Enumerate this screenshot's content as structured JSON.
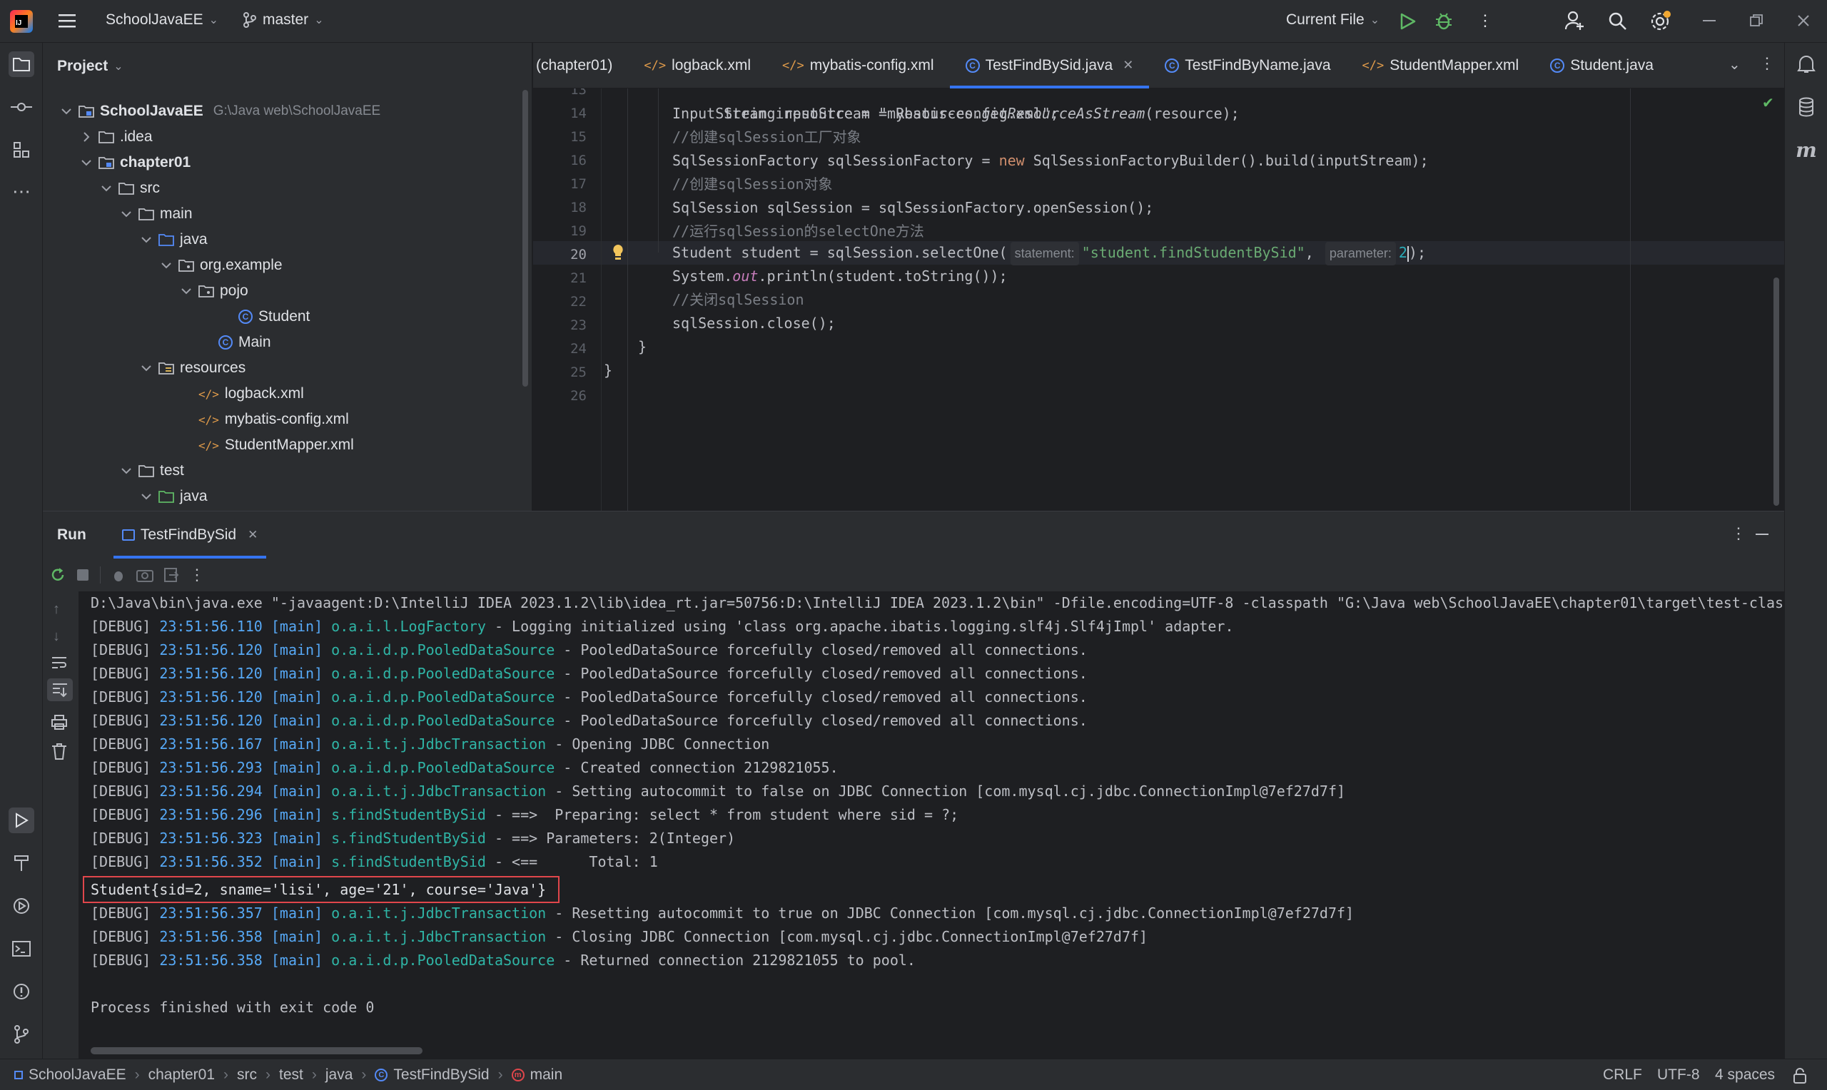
{
  "titlebar": {
    "project": "SchoolJavaEE",
    "branch": "master",
    "run_config": "Current File"
  },
  "project_panel": {
    "title": "Project",
    "tree": [
      {
        "label": "SchoolJavaEE",
        "path": "G:\\Java web\\SchoolJavaEE"
      },
      {
        "label": ".idea"
      },
      {
        "label": "chapter01"
      },
      {
        "label": "src"
      },
      {
        "label": "main"
      },
      {
        "label": "java"
      },
      {
        "label": "org.example"
      },
      {
        "label": "pojo"
      },
      {
        "label": "Student"
      },
      {
        "label": "Main"
      },
      {
        "label": "resources"
      },
      {
        "label": "logback.xml"
      },
      {
        "label": "mybatis-config.xml"
      },
      {
        "label": "StudentMapper.xml"
      },
      {
        "label": "test"
      },
      {
        "label": "java"
      }
    ]
  },
  "tabs": [
    {
      "label": "(chapter01)"
    },
    {
      "label": "logback.xml"
    },
    {
      "label": "mybatis-config.xml"
    },
    {
      "label": "TestFindBySid.java"
    },
    {
      "label": "TestFindByName.java"
    },
    {
      "label": "StudentMapper.xml"
    },
    {
      "label": "Student.java"
    }
  ],
  "editor": {
    "line_numbers": [
      "13",
      "14",
      "15",
      "16",
      "17",
      "18",
      "19",
      "20",
      "21",
      "22",
      "23",
      "24",
      "25",
      "26"
    ],
    "lines": {
      "l13": "String resource = \"mybatis-config.xml\";",
      "l14a": "InputStream inputStream = Resources.",
      "l14b": "getResourceAsStream",
      "l14c": "(resource);",
      "l15": "//创建sqlSession工厂对象",
      "l16a": "SqlSessionFactory sqlSessionFactory = ",
      "l16b": "new",
      "l16c": " SqlSessionFactoryBuilder().build(inputStream);",
      "l17": "//创建sqlSession对象",
      "l18": "SqlSession sqlSession = sqlSessionFactory.openSession();",
      "l19": "//运行sqlSession的selectOne方法",
      "l20a": "Student student = sqlSession.selectOne(",
      "l20_hint1": "statement:",
      "l20b": "\"student.findStudentBySid\"",
      "l20c": ", ",
      "l20_hint2": "parameter:",
      "l20d": "2",
      "l20e": ");",
      "l21a": "System.",
      "l21b": "out",
      "l21c": ".println(student.toString());",
      "l22": "//关闭sqlSession",
      "l23": "sqlSession.close();",
      "l24": "}",
      "l25": "}"
    }
  },
  "run_panel": {
    "title": "Run",
    "tab": "TestFindBySid",
    "cmd": "D:\\Java\\bin\\java.exe \"-javaagent:D:\\IntelliJ IDEA 2023.1.2\\lib\\idea_rt.jar=50756:D:\\IntelliJ IDEA 2023.1.2\\bin\" -Dfile.encoding=UTF-8 -classpath \"G:\\Java web\\SchoolJavaEE\\chapter01\\target\\test-class",
    "logs": [
      {
        "lvl": "[DEBUG]",
        "ts": "23:51:56.110",
        "thr": "[main]",
        "src": "o.a.i.l.LogFactory",
        "msg": " - Logging initialized using 'class org.apache.ibatis.logging.slf4j.Slf4jImpl' adapter."
      },
      {
        "lvl": "[DEBUG]",
        "ts": "23:51:56.120",
        "thr": "[main]",
        "src": "o.a.i.d.p.PooledDataSource",
        "msg": " - PooledDataSource forcefully closed/removed all connections."
      },
      {
        "lvl": "[DEBUG]",
        "ts": "23:51:56.120",
        "thr": "[main]",
        "src": "o.a.i.d.p.PooledDataSource",
        "msg": " - PooledDataSource forcefully closed/removed all connections."
      },
      {
        "lvl": "[DEBUG]",
        "ts": "23:51:56.120",
        "thr": "[main]",
        "src": "o.a.i.d.p.PooledDataSource",
        "msg": " - PooledDataSource forcefully closed/removed all connections."
      },
      {
        "lvl": "[DEBUG]",
        "ts": "23:51:56.120",
        "thr": "[main]",
        "src": "o.a.i.d.p.PooledDataSource",
        "msg": " - PooledDataSource forcefully closed/removed all connections."
      },
      {
        "lvl": "[DEBUG]",
        "ts": "23:51:56.167",
        "thr": "[main]",
        "src": "o.a.i.t.j.JdbcTransaction",
        "msg": " - Opening JDBC Connection"
      },
      {
        "lvl": "[DEBUG]",
        "ts": "23:51:56.293",
        "thr": "[main]",
        "src": "o.a.i.d.p.PooledDataSource",
        "msg": " - Created connection 2129821055."
      },
      {
        "lvl": "[DEBUG]",
        "ts": "23:51:56.294",
        "thr": "[main]",
        "src": "o.a.i.t.j.JdbcTransaction",
        "msg": " - Setting autocommit to false on JDBC Connection [com.mysql.cj.jdbc.ConnectionImpl@7ef27d7f]"
      },
      {
        "lvl": "[DEBUG]",
        "ts": "23:51:56.296",
        "thr": "[main]",
        "src": "s.findStudentBySid",
        "msg": " - ==>  Preparing: select * from student where sid = ?;"
      },
      {
        "lvl": "[DEBUG]",
        "ts": "23:51:56.323",
        "thr": "[main]",
        "src": "s.findStudentBySid",
        "msg": " - ==> Parameters: 2(Integer)"
      },
      {
        "lvl": "[DEBUG]",
        "ts": "23:51:56.352",
        "thr": "[main]",
        "src": "s.findStudentBySid",
        "msg": " - <==      Total: 1"
      }
    ],
    "result": "Student{sid=2, sname='lisi', age='21', course='Java'}",
    "logs2": [
      {
        "lvl": "[DEBUG]",
        "ts": "23:51:56.357",
        "thr": "[main]",
        "src": "o.a.i.t.j.JdbcTransaction",
        "msg": " - Resetting autocommit to true on JDBC Connection [com.mysql.cj.jdbc.ConnectionImpl@7ef27d7f]"
      },
      {
        "lvl": "[DEBUG]",
        "ts": "23:51:56.358",
        "thr": "[main]",
        "src": "o.a.i.t.j.JdbcTransaction",
        "msg": " - Closing JDBC Connection [com.mysql.cj.jdbc.ConnectionImpl@7ef27d7f]"
      },
      {
        "lvl": "[DEBUG]",
        "ts": "23:51:56.358",
        "thr": "[main]",
        "src": "o.a.i.d.p.PooledDataSource",
        "msg": " - Returned connection 2129821055 to pool."
      }
    ],
    "exit": "Process finished with exit code 0"
  },
  "statusbar": {
    "crumbs": [
      "SchoolJavaEE",
      "chapter01",
      "src",
      "test",
      "java",
      "TestFindBySid",
      "main"
    ],
    "line_sep": "CRLF",
    "encoding": "UTF-8",
    "indent": "4 spaces"
  },
  "colors": {
    "accent": "#3574f0",
    "run_green": "#5fb865",
    "highlight_box": "#e0464b"
  }
}
